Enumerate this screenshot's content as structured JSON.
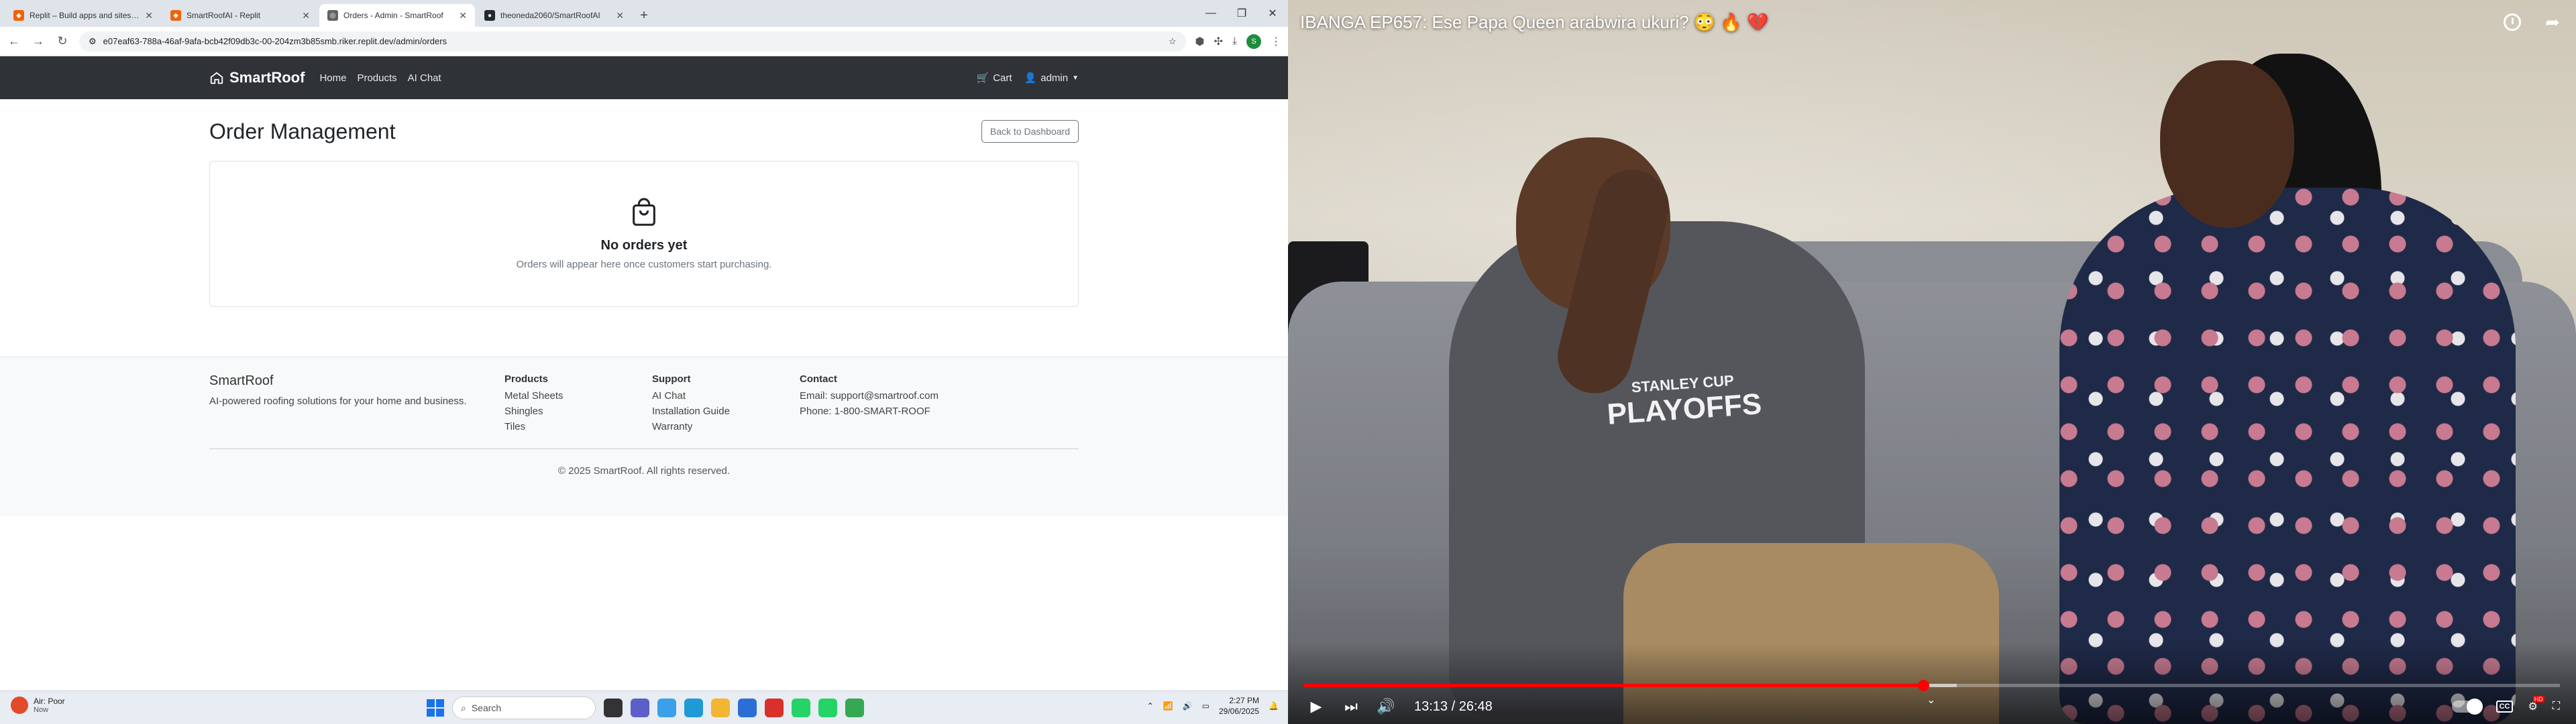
{
  "browser": {
    "tabs": [
      {
        "title": "Replit – Build apps and sites with",
        "fav_color": "#f26207",
        "active": false
      },
      {
        "title": "SmartRoofAI - Replit",
        "fav_color": "#f26207",
        "active": false
      },
      {
        "title": "Orders - Admin - SmartRoof",
        "fav_color": "#5f6368",
        "active": true
      },
      {
        "title": "theoneda2060/SmartRoofAI",
        "fav_color": "#24292f",
        "active": false
      }
    ],
    "url": "e07eaf63-788a-46af-9afa-bcb42f09db3c-00-204zm3b85smb.riker.replit.dev/admin/orders"
  },
  "app": {
    "brand": "SmartRoof",
    "nav": {
      "home": "Home",
      "products": "Products",
      "ai_chat": "AI Chat"
    },
    "cart": "Cart",
    "user": "admin",
    "page_title": "Order Management",
    "back_button": "Back to Dashboard",
    "empty": {
      "title": "No orders yet",
      "subtitle": "Orders will appear here once customers start purchasing."
    },
    "footer": {
      "brand": "SmartRoof",
      "tagline": "AI-powered roofing solutions for your home and business.",
      "products_head": "Products",
      "products": [
        "Metal Sheets",
        "Shingles",
        "Tiles"
      ],
      "support_head": "Support",
      "support": [
        "AI Chat",
        "Installation Guide",
        "Warranty"
      ],
      "contact_head": "Contact",
      "contact": [
        "Email: support@smartroof.com",
        "Phone: 1-800-SMART-ROOF"
      ],
      "copyright": "© 2025 SmartRoof. All rights reserved."
    }
  },
  "taskbar": {
    "weather_title": "Air: Poor",
    "weather_sub": "Now",
    "search_placeholder": "Search",
    "time": "2:27 PM",
    "date": "29/06/2025"
  },
  "video": {
    "title": "IBANGA EP657: Ese Papa Queen arabwira ukuri? 😳 🔥 💔",
    "time_display": "13:13 / 26:48",
    "played_fraction": 0.4932,
    "buffered_fraction": 0.52,
    "shirt_line1": "STANLEY CUP",
    "shirt_line2": "PLAYOFFS"
  }
}
